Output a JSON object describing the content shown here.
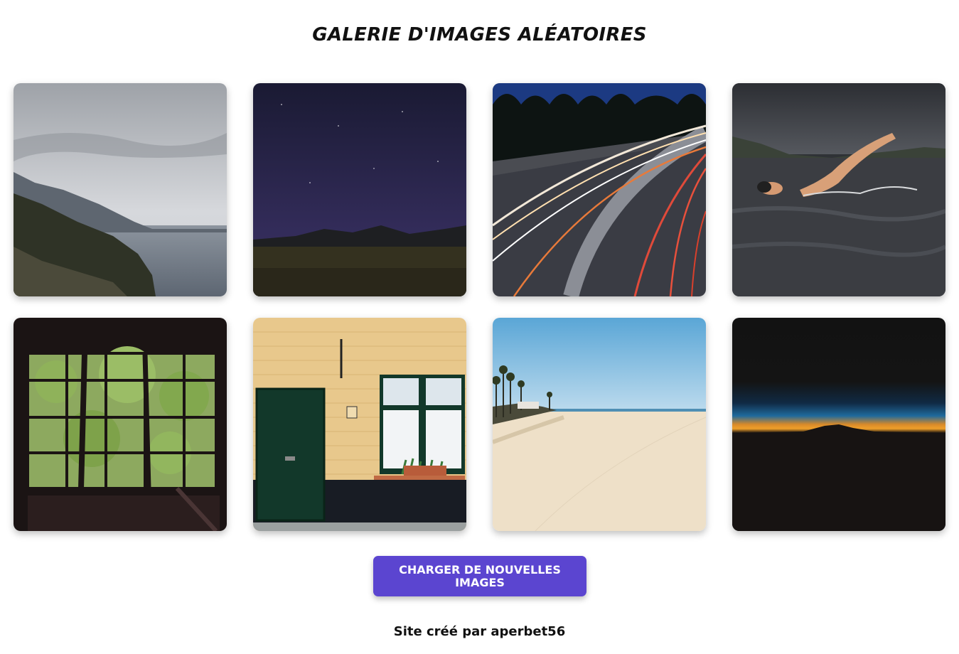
{
  "page": {
    "title": "GALERIE D'IMAGES ALÉATOIRES",
    "load_button_label": "CHARGER DE NOUVELLES IMAGES",
    "footer": "Site créé par aperbet56"
  },
  "colors": {
    "button_bg": "#5b45d0",
    "button_text": "#ffffff",
    "text": "#111111"
  },
  "gallery": {
    "images": [
      {
        "name": "coastal-mountains-image"
      },
      {
        "name": "night-sky-field-image"
      },
      {
        "name": "light-trails-road-image"
      },
      {
        "name": "swimmer-image"
      },
      {
        "name": "window-trees-image"
      },
      {
        "name": "door-building-image"
      },
      {
        "name": "beach-image"
      },
      {
        "name": "sunset-horizon-image"
      }
    ]
  }
}
